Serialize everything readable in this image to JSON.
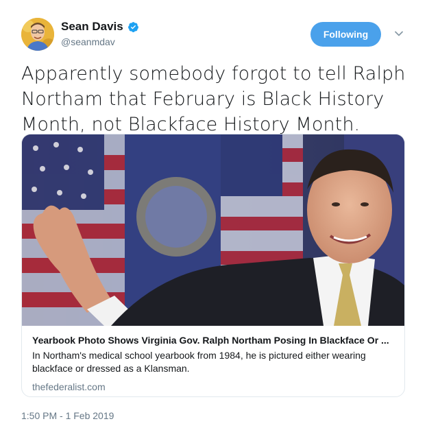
{
  "author": {
    "display_name": "Sean Davis",
    "handle": "@seanmdav",
    "verified_icon": "verified-badge-icon"
  },
  "actions": {
    "follow_label": "Following",
    "menu_icon": "chevron-down-icon"
  },
  "tweet": {
    "text": "Apparently somebody forgot to tell Ralph Northam that February is Black History Month, not Blackface History Month.",
    "timestamp": "1:50 PM - 1 Feb 2019"
  },
  "card": {
    "title": "Yearbook Photo Shows Virginia Gov. Ralph Northam Posing In Blackface Or ...",
    "description": "In Northam's medical school yearbook from 1984, he is pictured either wearing blackface or dressed as a Klansman.",
    "domain": "thefederalist.com"
  },
  "colors": {
    "accent": "#4aa1eb",
    "secondary_text": "#657786",
    "border": "#e1e8ed"
  }
}
